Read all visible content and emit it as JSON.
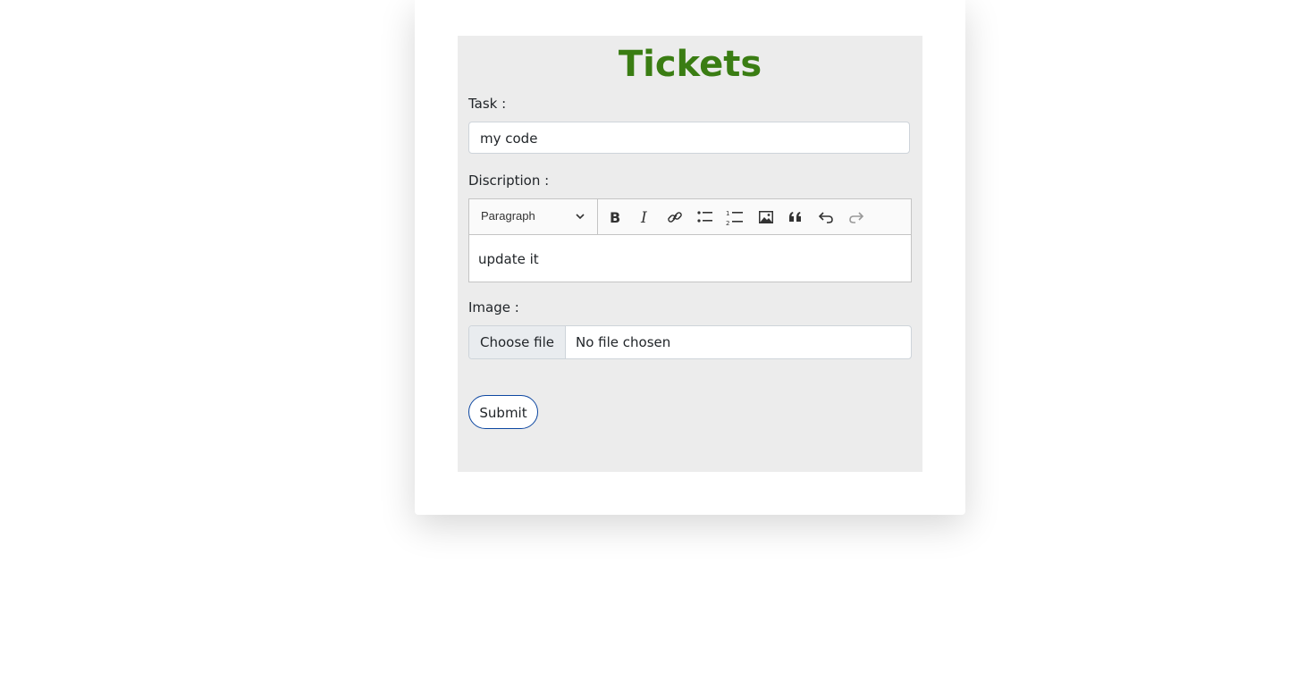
{
  "page": {
    "title": "Tickets"
  },
  "form": {
    "task_label": "Task :",
    "task_value": "my code",
    "description_label": "Discription :",
    "editor": {
      "heading_select": "Paragraph",
      "toolbar_icons": [
        "bold-icon",
        "italic-icon",
        "link-icon",
        "bulleted-list-icon",
        "numbered-list-icon",
        "image-icon",
        "blockquote-icon",
        "undo-icon",
        "redo-icon"
      ],
      "content": "update it"
    },
    "image_label": "Image :",
    "file_button": "Choose file",
    "file_status": "No file chosen",
    "submit_label": "Submit"
  },
  "colors": {
    "title": "#3a7d13",
    "panel": "#ececec",
    "submit_border": "#0d47a1"
  }
}
